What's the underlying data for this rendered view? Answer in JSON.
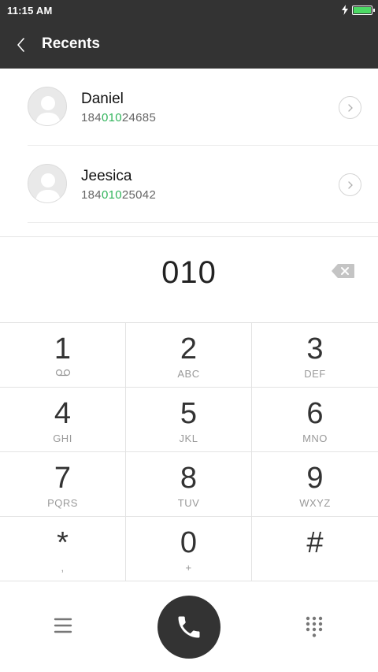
{
  "status_bar": {
    "time": "11:15 AM",
    "battery_level": 1.0,
    "charging": true,
    "battery_color": "#4cd964"
  },
  "header": {
    "title": "Recents",
    "back_icon": "chevron-left-icon"
  },
  "recents": [
    {
      "name": "Daniel",
      "number_prefix": "184",
      "number_match": "010",
      "number_suffix": "24685"
    },
    {
      "name": "Jeesica",
      "number_prefix": "184",
      "number_match": "010",
      "number_suffix": "25042"
    }
  ],
  "input": {
    "dialed": "010",
    "delete_icon": "backspace-icon"
  },
  "keypad": [
    {
      "digit": "1",
      "letters": "",
      "sub_icon": "voicemail-icon"
    },
    {
      "digit": "2",
      "letters": "ABC"
    },
    {
      "digit": "3",
      "letters": "DEF"
    },
    {
      "digit": "4",
      "letters": "GHI"
    },
    {
      "digit": "5",
      "letters": "JKL"
    },
    {
      "digit": "6",
      "letters": "MNO"
    },
    {
      "digit": "7",
      "letters": "PQRS"
    },
    {
      "digit": "8",
      "letters": "TUV"
    },
    {
      "digit": "9",
      "letters": "WXYZ"
    },
    {
      "digit": "*",
      "letters": ","
    },
    {
      "digit": "0",
      "letters": "+"
    },
    {
      "digit": "#",
      "letters": ""
    }
  ],
  "bottom_bar": {
    "menu_icon": "menu-icon",
    "call_icon": "phone-icon",
    "dialpad_icon": "dialpad-icon"
  },
  "colors": {
    "header_bg": "#333333",
    "match_highlight": "#31b45b",
    "call_button": "#333333"
  }
}
